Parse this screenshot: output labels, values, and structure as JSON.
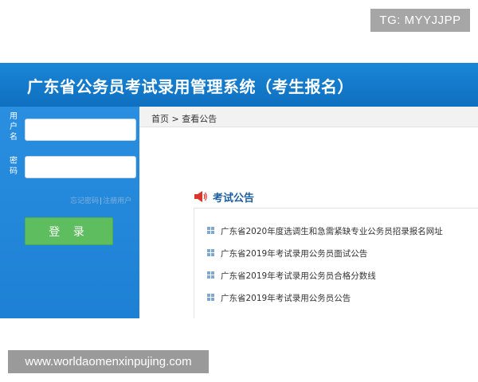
{
  "overlay": {
    "tg_badge": "TG: MYYJJPP",
    "watermark": "www.worldaomenxinpujing.com"
  },
  "header": {
    "title": "广东省公务员考试录用管理系统（考生报名）"
  },
  "login": {
    "username_label": "用户名",
    "password_label": "密码",
    "username_value": "",
    "password_value": "",
    "forgot_password": "忘记密码",
    "register": "注册用户",
    "separator": "|",
    "login_button": "登 录"
  },
  "main": {
    "breadcrumb": "首页 > 查看公告",
    "section_title": "考试公告",
    "notices": [
      "广东省2020年度选调生和急需紧缺专业公务员招录报名网址",
      "广东省2019年考试录用公务员面试公告",
      "广东省2019年考试录用公务员合格分数线",
      "广东省2019年考试录用公务员公告"
    ]
  },
  "colors": {
    "header_blue": "#0f6fc0",
    "sidebar_blue": "#1d80d4",
    "login_green": "#5ebd5e",
    "section_title": "#1d5f9e",
    "speaker_red": "#d9352b"
  },
  "icons": {
    "section": "speaker-icon",
    "notice_bullet": "grid-bullet-icon"
  }
}
